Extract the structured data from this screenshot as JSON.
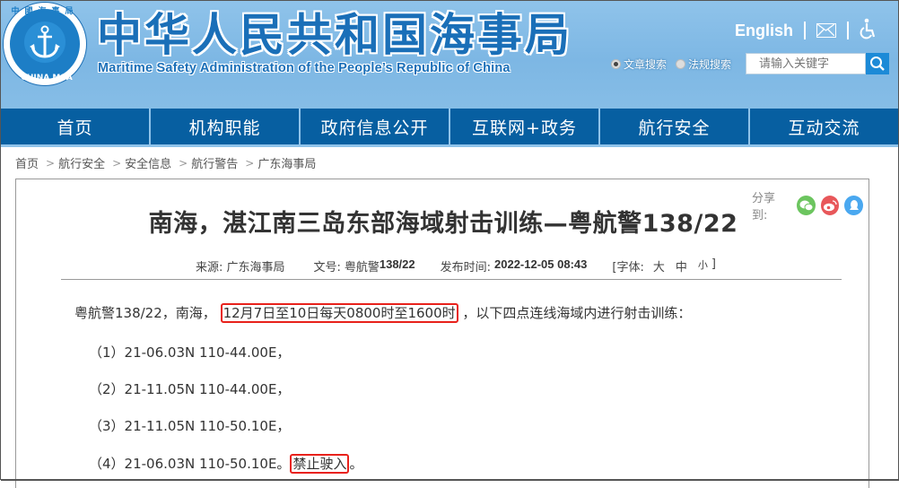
{
  "header": {
    "logo": {
      "ring_text_cn": "中國海事局",
      "ring_text_en": "CHINA MSA",
      "icon": "anchor-icon"
    },
    "title_cn": "中华人民共和国海事局",
    "title_en": "Maritime Safety Administration of the People’s Republic of China",
    "top_links": {
      "english": "English",
      "mail_icon": "mail-icon",
      "accessibility_icon": "accessibility-icon"
    },
    "search": {
      "options": [
        {
          "label": "文章搜索",
          "selected": true
        },
        {
          "label": "法规搜索",
          "selected": false
        }
      ],
      "placeholder": "请输入关键字",
      "button_icon": "search-icon"
    }
  },
  "nav": {
    "items": [
      "首页",
      "机构职能",
      "政府信息公开",
      "互联网+政务",
      "航行安全",
      "互动交流"
    ]
  },
  "breadcrumb": {
    "separator": ">",
    "items": [
      "首页",
      "航行安全",
      "安全信息",
      "航行警告",
      "广东海事局"
    ]
  },
  "article": {
    "share": {
      "label": "分享到:",
      "icons": [
        {
          "name": "wechat-icon",
          "color": "#6cc55f"
        },
        {
          "name": "weibo-icon",
          "color": "#e8575a"
        },
        {
          "name": "qq-icon",
          "color": "#4aa8f0"
        }
      ]
    },
    "title": "南海，湛江南三岛东部海域射击训练—粤航警138/22",
    "meta": {
      "source_label": "来源:",
      "source": "广东海事局",
      "doc_no_label": "文号:",
      "doc_no_prefix": "粤航警",
      "doc_no": "138/22",
      "publish_label": "发布时间:",
      "publish_time": "2022-12-05 08:43",
      "font_label": "[字体:",
      "font_sizes": [
        "大",
        "中",
        "小"
      ],
      "font_close": "]"
    },
    "body": {
      "intro_prefix": "粤航警138/22，南海，",
      "intro_highlight": "12月7日至10日每天0800时至1600时",
      "intro_suffix": "，以下四点连线海域内进行射击训练：",
      "points": [
        "（1）21-06.03N 110-44.00E，",
        "（2）21-11.05N 110-44.00E，",
        "（3）21-11.05N 110-50.10E，",
        "（4）21-06.03N 110-50.10E。"
      ],
      "closing_highlight": "禁止驶入",
      "closing_suffix": "。"
    },
    "highlight_color": "#e8211b"
  }
}
